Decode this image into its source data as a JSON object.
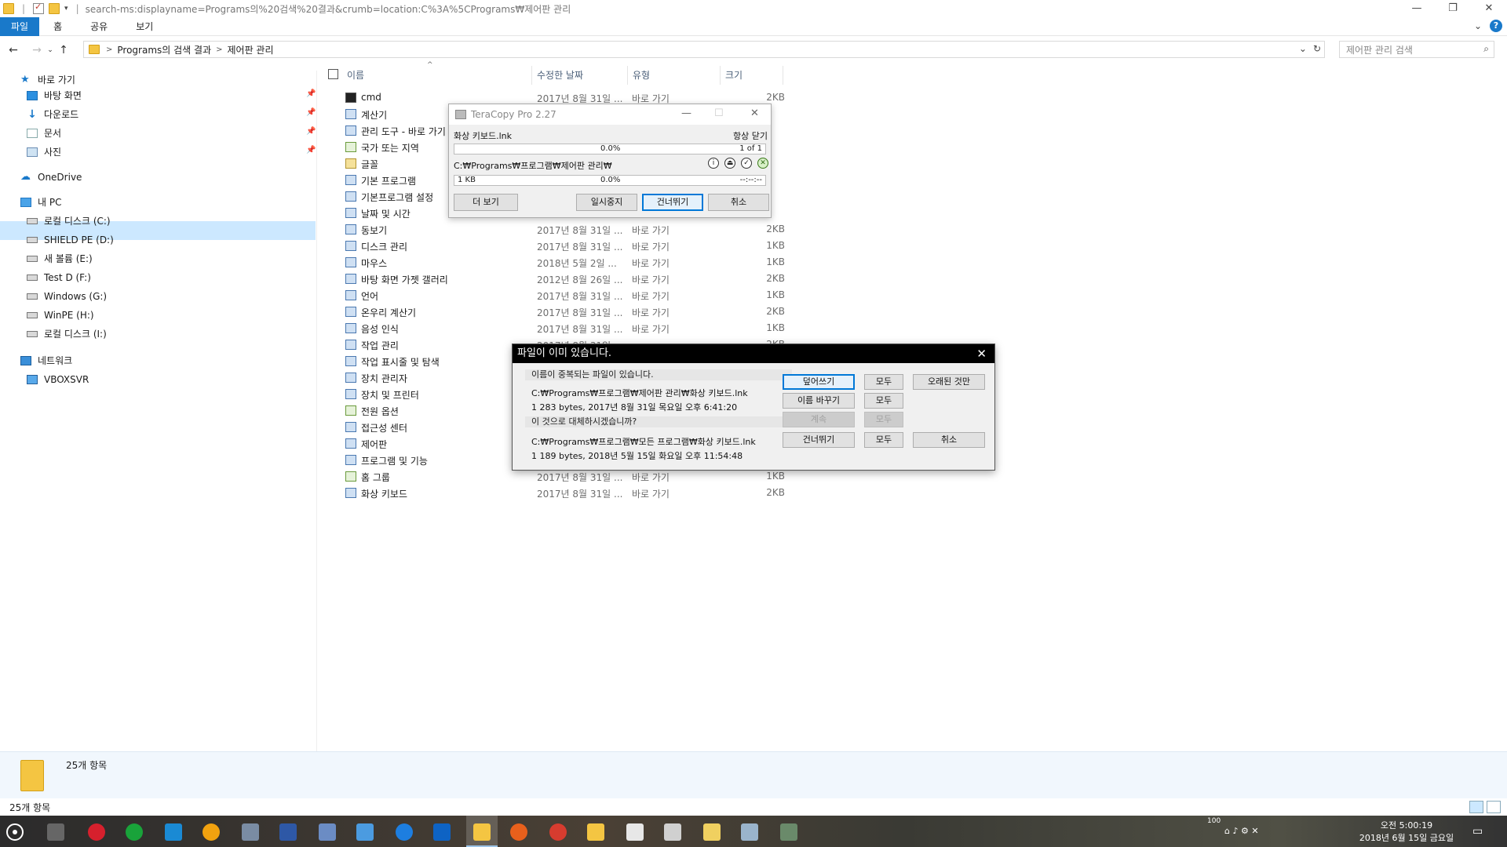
{
  "window": {
    "title": "search-ms:displayname=Programs의%20검색%20결과&crumb=location:C%3A%5CPrograms₩제어판 관리",
    "minimize": "—",
    "maximize": "❐",
    "close": "✕"
  },
  "ribbon": {
    "tabs": [
      "파일",
      "홈",
      "공유",
      "보기"
    ],
    "help": "?",
    "expand": "⌄"
  },
  "address": {
    "back": "←",
    "forward": "→",
    "recent": "⌄",
    "up": "↑",
    "crumbs": [
      "Programs의 검색 결과",
      "제어판 관리"
    ],
    "crumb_sep": ">",
    "dropdown": "⌄",
    "refresh": "↻",
    "search_placeholder": "제어판 관리 검색",
    "search_icon": "⌕"
  },
  "nav": {
    "quick_access": "바로 가기",
    "items": [
      {
        "label": "바탕 화면",
        "pinned": true
      },
      {
        "label": "다운로드",
        "pinned": true
      },
      {
        "label": "문서",
        "pinned": true
      },
      {
        "label": "사진",
        "pinned": true
      }
    ],
    "onedrive": "OneDrive",
    "this_pc": "내 PC",
    "drives": [
      "로컬 디스크 (C:)",
      "SHIELD PE (D:)",
      "새 볼륨 (E:)",
      "Test D (F:)",
      "Windows (G:)",
      "WinPE (H:)",
      "로컬 디스크 (I:)"
    ],
    "network": "네트워크",
    "network_items": [
      "VBOXSVR"
    ]
  },
  "columns": {
    "name": "이름",
    "date": "수정한 날짜",
    "type": "유형",
    "size": "크기",
    "sort": "^"
  },
  "files": [
    {
      "name": "cmd",
      "date": "2017년 8월 31일 ...",
      "type": "바로 가기",
      "size": "2KB"
    },
    {
      "name": "계산기",
      "date": "",
      "type": "",
      "size": ""
    },
    {
      "name": "관리 도구 - 바로 가기",
      "date": "",
      "type": "",
      "size": ""
    },
    {
      "name": "국가 또는 지역",
      "date": "",
      "type": "",
      "size": ""
    },
    {
      "name": "글꼴",
      "date": "",
      "type": "",
      "size": ""
    },
    {
      "name": "기본 프로그램",
      "date": "",
      "type": "",
      "size": ""
    },
    {
      "name": "기본프로그램 설정",
      "date": "",
      "type": "",
      "size": ""
    },
    {
      "name": "날짜 및 시간",
      "date": "",
      "type": "",
      "size": ""
    },
    {
      "name": "동보기",
      "date": "2017년 8월 31일 ...",
      "type": "바로 가기",
      "size": "2KB"
    },
    {
      "name": "디스크 관리",
      "date": "2017년 8월 31일 ...",
      "type": "바로 가기",
      "size": "1KB"
    },
    {
      "name": "마우스",
      "date": "2018년 5월 2일 ...",
      "type": "바로 가기",
      "size": "1KB"
    },
    {
      "name": "바탕 화면 가젯 갤러리",
      "date": "2012년 8월 26일 ...",
      "type": "바로 가기",
      "size": "2KB"
    },
    {
      "name": "언어",
      "date": "2017년 8월 31일 ...",
      "type": "바로 가기",
      "size": "1KB"
    },
    {
      "name": "온우리 계산기",
      "date": "2017년 8월 31일 ...",
      "type": "바로 가기",
      "size": "2KB"
    },
    {
      "name": "음성 인식",
      "date": "2017년 8월 31일 ...",
      "type": "바로 가기",
      "size": "1KB"
    },
    {
      "name": "작업 관리",
      "date": "2017년 8월 31일",
      "type": "",
      "size": "2KB"
    },
    {
      "name": "작업 표시줄 및 탐색",
      "date": "",
      "type": "",
      "size": ""
    },
    {
      "name": "장치 관리자",
      "date": "",
      "type": "",
      "size": ""
    },
    {
      "name": "장치 및 프린터",
      "date": "",
      "type": "",
      "size": ""
    },
    {
      "name": "전원 옵션",
      "date": "",
      "type": "",
      "size": ""
    },
    {
      "name": "접근성 센터",
      "date": "",
      "type": "",
      "size": ""
    },
    {
      "name": "제어판",
      "date": "",
      "type": "",
      "size": ""
    },
    {
      "name": "프로그램 및 기능",
      "date": "",
      "type": "",
      "size": ""
    },
    {
      "name": "홈 그룹",
      "date": "2017년 8월 31일 ...",
      "type": "바로 가기",
      "size": "1KB"
    },
    {
      "name": "화상 키보드",
      "date": "2017년 8월 31일 ...",
      "type": "바로 가기",
      "size": "2KB"
    }
  ],
  "details": {
    "count": "25개 항목"
  },
  "status": {
    "count": "25개 항목"
  },
  "teracopy": {
    "title": "TeraCopy Pro 2.27",
    "minimize": "—",
    "maximize": "☐",
    "close": "✕",
    "file": "화상 키보드.lnk",
    "always_close": "항상 닫기",
    "progress1": "0.0%",
    "count": "1 of 1",
    "path": "C:₩Programs₩프로그램₩제어판 관리₩",
    "size": "1 KB",
    "progress2": "0.0%",
    "time": "--:--:--",
    "icons": [
      "i",
      "⏏",
      "✓",
      "✕"
    ],
    "buttons": {
      "more": "더 보기",
      "pause": "일시중지",
      "skip": "건너뛰기",
      "cancel": "취소"
    }
  },
  "conflict": {
    "title": "파일이 이미 있습니다.",
    "close": "✕",
    "exists_label": "이름이 중복되는 파일이 있습니다.",
    "existing_path": "C:₩Programs₩프로그램₩제어판 관리₩화상 키보드.lnk",
    "existing_info": "1 283 bytes, 2017년 8월 31일 목요일 오후 6:41:20",
    "replace_label": "이 것으로 대체하시겠습니까?",
    "new_path": "C:₩Programs₩프로그램₩모든 프로그램₩화상 키보드.lnk",
    "new_info": "1 189 bytes, 2018년 5월 15일 화요일 오후 11:54:48",
    "buttons": {
      "overwrite": "덮어쓰기",
      "all1": "모두",
      "older_only": "오래된 것만",
      "rename": "이름 바꾸기",
      "all2": "모두",
      "continue": "계속",
      "all3": "모두",
      "skip": "건너뛰기",
      "all4": "모두",
      "cancel": "취소"
    }
  },
  "taskbar": {
    "time": "오전 5:00:19",
    "date": "2018년 6월 15일 금요일",
    "battery": "100"
  }
}
